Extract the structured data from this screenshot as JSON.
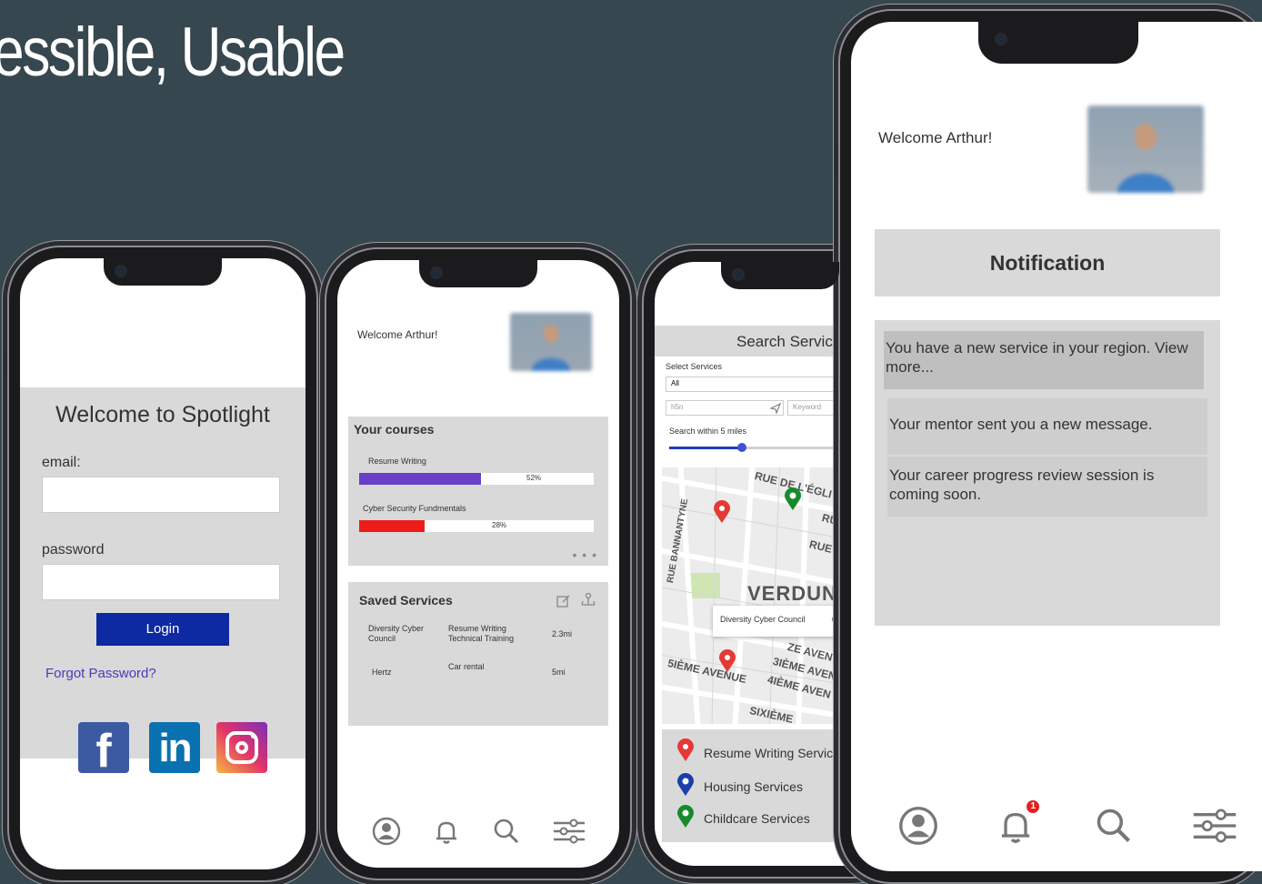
{
  "slide": {
    "title": "essible, Usable"
  },
  "login_screen": {
    "title": "Welcome to Spotlight",
    "email_label": "email:",
    "email_value": "",
    "password_label": "password",
    "password_value": "",
    "login_label": "Login",
    "forgot_label": "Forgot Password?",
    "social": [
      "facebook-icon",
      "linkedin-icon",
      "instagram-icon"
    ]
  },
  "home_screen": {
    "welcome": "Welcome Arthur!",
    "courses_title": "Your courses",
    "courses": [
      {
        "name": "Resume Writing",
        "progress": 0.52,
        "label": "52%",
        "color": "#6a3fc8"
      },
      {
        "name": "Cyber Security Fundmentals",
        "progress": 0.28,
        "label": "28%",
        "color": "#ee1b1b"
      }
    ],
    "more_label": "• • •",
    "saved_title": "Saved Services",
    "saved_services": [
      {
        "org": "Diversity Cyber Council",
        "service": "Resume Writing Technical Training",
        "distance": "2.3mi"
      },
      {
        "org": "Hertz",
        "service": "Car rental",
        "distance": "5mi"
      }
    ],
    "nav": [
      "profile-icon",
      "bell-icon",
      "search-icon",
      "filter-icon"
    ]
  },
  "search_screen": {
    "title": "Search Servic",
    "select_label": "Select Services",
    "select_value": "All",
    "location_value": "h5n",
    "keyword_placeholder": "Keyword",
    "radius_label": "Search within 5 miles",
    "radius_value": 0.4,
    "map": {
      "street_top": "RUE DE L'ÉGLI",
      "street_side": "RUE BANNANTYNE",
      "district": "VERDUN",
      "street_ru": "RU",
      "street_rue": "RUE",
      "popup": "Diversity Cyber Council",
      "ave_5": "5IÈME AVENUE",
      "ave_ze": "ZE AVEN",
      "ave_3": "3IÈME AVEN",
      "ave_4": "4IÈME AVEN",
      "ave_6": "SIXIÈME"
    },
    "legend": [
      {
        "label": "Resume Writing Servic",
        "color": "#e53935"
      },
      {
        "label": "Housing Services",
        "color": "#1a3fa8"
      },
      {
        "label": "Childcare Services",
        "color": "#178a2c"
      }
    ]
  },
  "notification_screen": {
    "welcome": "Welcome Arthur!",
    "title": "Notification",
    "notifications": [
      "You have a new service in your region. View more...",
      "Your mentor sent you a new message.",
      "Your career progress review session is coming soon."
    ],
    "bell_badge": "1",
    "nav": [
      "profile-icon",
      "bell-icon",
      "search-icon",
      "filter-icon"
    ]
  }
}
